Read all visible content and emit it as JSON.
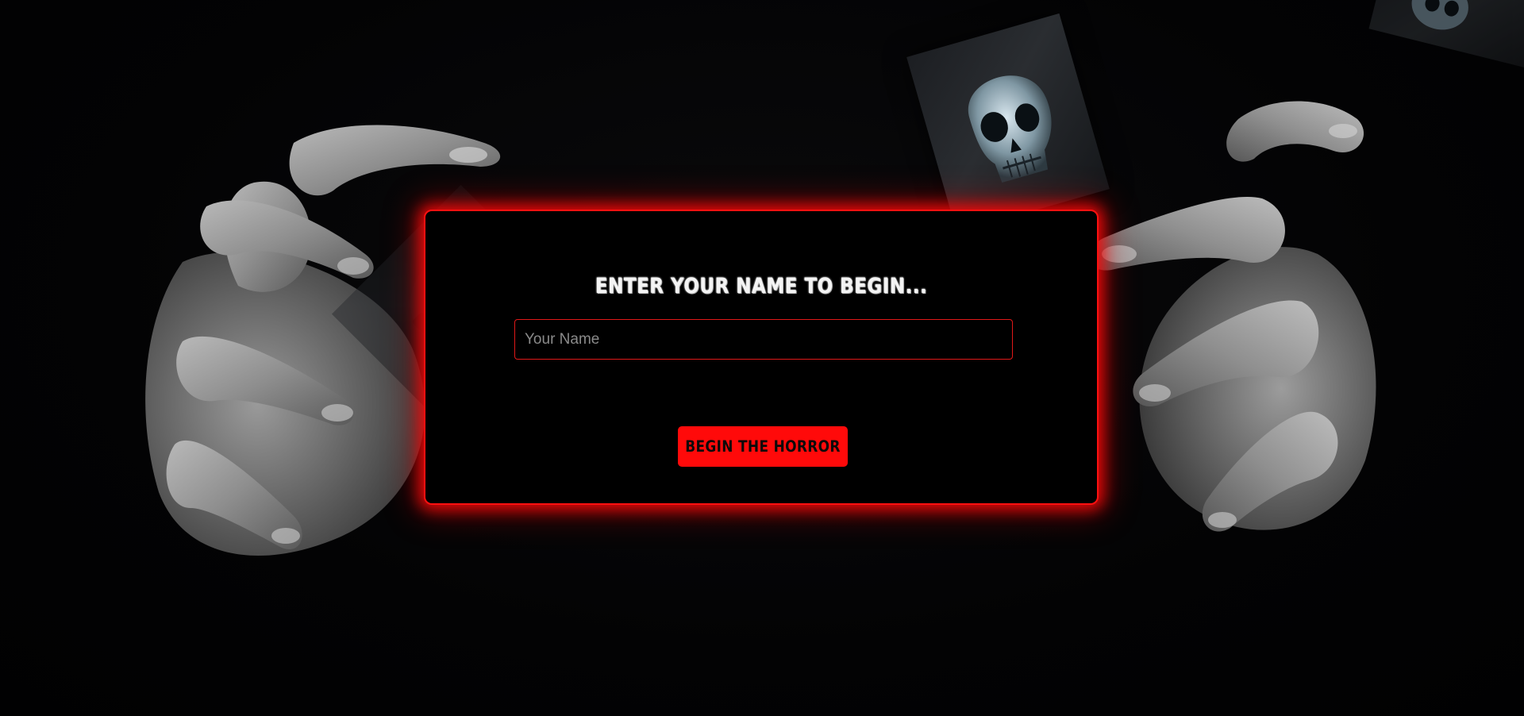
{
  "form": {
    "title": "ENTER YOUR NAME TO BEGIN...",
    "name_placeholder": "Your Name",
    "name_value": "",
    "submit_label": "BEGIN THE HORROR"
  },
  "colors": {
    "background": "#020203",
    "accent": "#ff0a0a",
    "panel": "#000000",
    "title_text": "#f4f4f4"
  },
  "decor": {
    "left_image": "reaching-hand",
    "right_image": "reaching-hand",
    "skull_images": [
      "skull-image",
      "skull-image",
      "skull-image"
    ]
  }
}
